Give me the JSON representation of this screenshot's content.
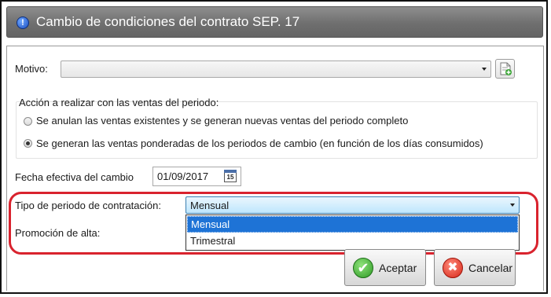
{
  "window": {
    "title": "Cambio de condiciones del contrato SEP. 17",
    "title_icon": "info-icon"
  },
  "motivo": {
    "label": "Motivo:",
    "value": ""
  },
  "accion": {
    "label": "Acción a realizar con las ventas del periodo:",
    "options": [
      {
        "label": "Se anulan las ventas existentes y se generan nuevas ventas del periodo completo",
        "selected": false
      },
      {
        "label": "Se generan las ventas ponderadas de los periodos de cambio (en función de los días consumidos)",
        "selected": true
      }
    ]
  },
  "fecha": {
    "label": "Fecha efectiva del cambio",
    "value": "01/09/2017",
    "icon_day": "15"
  },
  "tipo_periodo": {
    "label": "Tipo de periodo de contratación:",
    "value": "Mensual",
    "options": [
      "Mensual",
      "Trimestral"
    ],
    "selected_index": 0
  },
  "promocion": {
    "label": "Promoción de alta:"
  },
  "buttons": {
    "ok": "Aceptar",
    "ok_icon": "✔",
    "cancel": "Cancelar",
    "cancel_icon": "✖"
  },
  "colors": {
    "highlight": "#d9232e",
    "selection": "#1e73d6",
    "titlebar": "#767676"
  }
}
